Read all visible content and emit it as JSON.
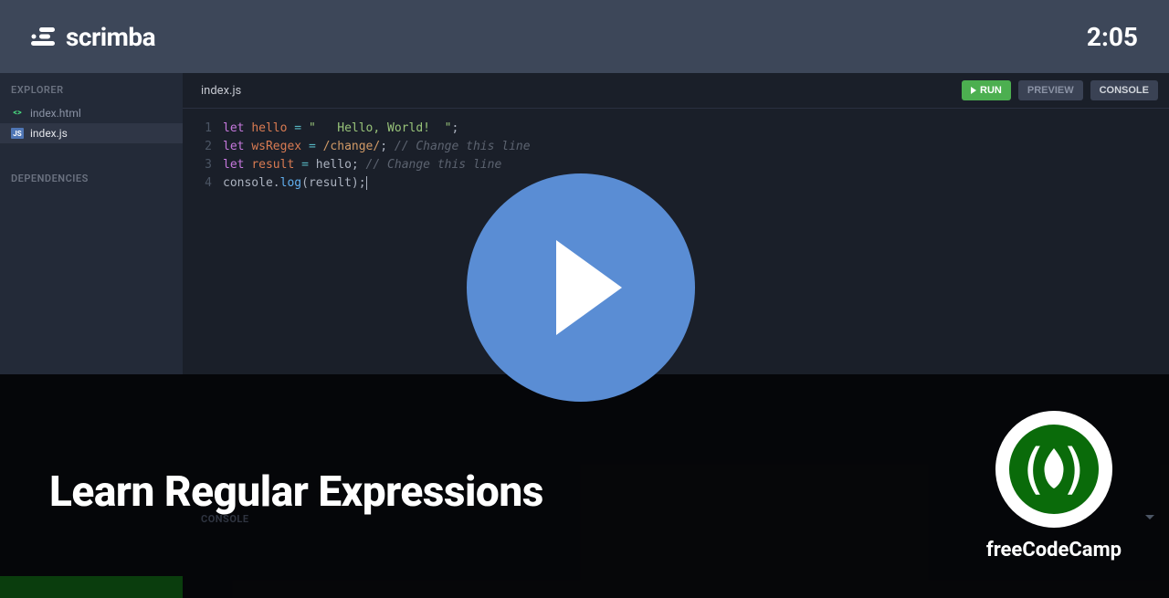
{
  "header": {
    "brand": "scrimba",
    "timestamp": "2:05"
  },
  "sidebar": {
    "explorer_label": "EXPLORER",
    "dependencies_label": "DEPENDENCIES",
    "files": [
      {
        "name": "index.html",
        "type": "html",
        "active": false
      },
      {
        "name": "index.js",
        "type": "js",
        "active": true
      }
    ]
  },
  "editor": {
    "filename": "index.js",
    "buttons": {
      "run": "RUN",
      "preview": "PREVIEW",
      "console": "CONSOLE"
    },
    "lines": [
      "1",
      "2",
      "3",
      "4"
    ],
    "code": {
      "l1": {
        "kw": "let",
        "var": "hello",
        "op": "=",
        "str": "\"   Hello, World!  \"",
        "semi": ";"
      },
      "l2": {
        "kw": "let",
        "var": "wsRegex",
        "op": "=",
        "reg": "/change/",
        "semi": ";",
        "com": " // Change this line"
      },
      "l3": {
        "kw": "let",
        "var": "result",
        "op": "=",
        "val": "hello",
        "semi": ";",
        "com": " // Change this line"
      },
      "l4": {
        "obj": "console",
        "dot": ".",
        "fn": "log",
        "open": "(",
        "arg": "result",
        "close": ")",
        "semi": ";"
      }
    }
  },
  "console": {
    "label": "CONSOLE"
  },
  "overlay": {
    "title": "Learn Regular Expressions",
    "author": "freeCodeCamp"
  }
}
